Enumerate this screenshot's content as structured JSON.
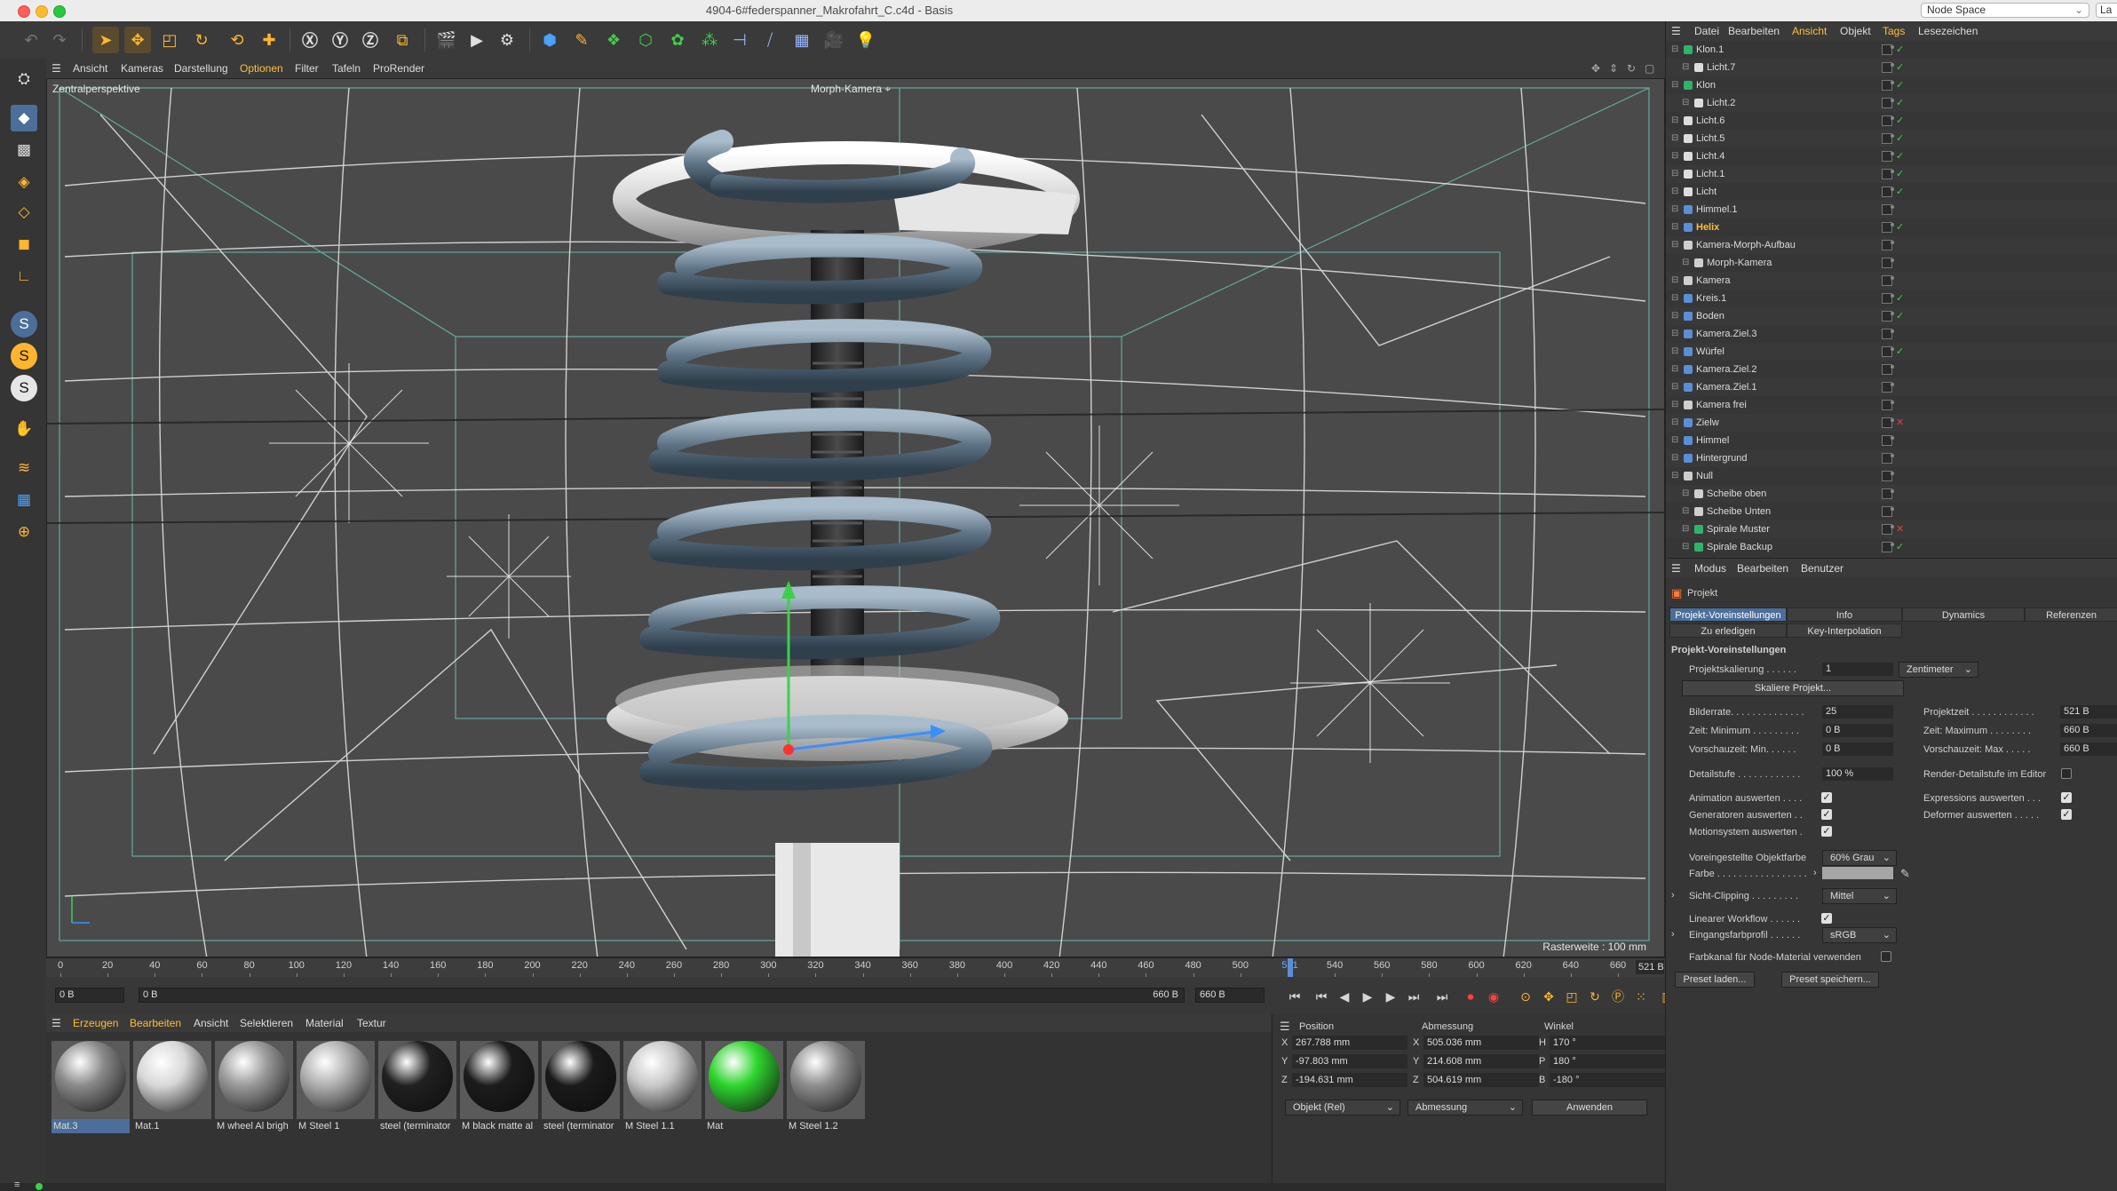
{
  "window": {
    "title": "4904-6#federspanner_Makrofahrt_C.c4d - Basis",
    "layout_label": "Node Space",
    "layout_extra": "La"
  },
  "viewport": {
    "menu": [
      "Ansicht",
      "Kameras",
      "Darstellung",
      "Optionen",
      "Filter",
      "Tafeln",
      "ProRender"
    ],
    "active_menu_index": 3,
    "projection": "Zentralperspektive",
    "camera": "Morph-Kamera",
    "grid_info": "Rasterweite : 100 mm"
  },
  "timeline": {
    "ticks": [
      "0",
      "20",
      "40",
      "60",
      "80",
      "100",
      "120",
      "140",
      "160",
      "180",
      "200",
      "220",
      "240",
      "260",
      "280",
      "300",
      "320",
      "340",
      "360",
      "380",
      "400",
      "420",
      "440",
      "460",
      "480",
      "500",
      "521",
      "540",
      "560",
      "580",
      "600",
      "620",
      "640",
      "660"
    ],
    "current_frame_marker": "521",
    "frame_display": "521 B",
    "start_field": "0 B",
    "range_start": "0 B",
    "range_end": "660 B",
    "end_field": "660 B"
  },
  "material_manager": {
    "menu": [
      "Erzeugen",
      "Bearbeiten",
      "Ansicht",
      "Selektieren",
      "Material",
      "Textur"
    ],
    "materials": [
      {
        "name": "Mat.3",
        "color": "#8a8a8a",
        "selected": true
      },
      {
        "name": "Mat.1",
        "color": "#d8d8d8",
        "selected": false
      },
      {
        "name": "M wheel Al brigh",
        "color": "#9a9a9a",
        "selected": false
      },
      {
        "name": "M Steel 1",
        "color": "#b0b0b0",
        "selected": false
      },
      {
        "name": "steel (terminator",
        "color": "#202020",
        "selected": false
      },
      {
        "name": "M black matte al",
        "color": "#1c1c1c",
        "selected": false
      },
      {
        "name": "steel (terminator",
        "color": "#1a1a1a",
        "selected": false
      },
      {
        "name": "M Steel 1.1",
        "color": "#c8c8c8",
        "selected": false
      },
      {
        "name": "Mat",
        "color": "#2ed52e",
        "selected": false
      },
      {
        "name": "M Steel 1.2",
        "color": "#8e8e8e",
        "selected": false
      }
    ]
  },
  "coordinates": {
    "headers": [
      "Position",
      "Abmessung",
      "Winkel"
    ],
    "rows": [
      {
        "axis": "X",
        "pos": "267.788 mm",
        "size_axis": "X",
        "size": "505.036 mm",
        "rot_axis": "H",
        "rot": "170 °"
      },
      {
        "axis": "Y",
        "pos": "-97.803 mm",
        "size_axis": "Y",
        "size": "214.608 mm",
        "rot_axis": "P",
        "rot": "180 °"
      },
      {
        "axis": "Z",
        "pos": "-194.631 mm",
        "size_axis": "Z",
        "size": "504.619 mm",
        "rot_axis": "B",
        "rot": "-180 °"
      }
    ],
    "mode": "Objekt (Rel)",
    "size_mode": "Abmessung",
    "apply": "Anwenden"
  },
  "object_manager": {
    "menu": [
      "Datei",
      "Bearbeiten",
      "Ansicht",
      "Objekt",
      "Tags",
      "Lesezeichen"
    ],
    "objects": [
      {
        "name": "Klon.1",
        "indent": 0,
        "icon": "#2fb36a",
        "state": "check",
        "highlight": false
      },
      {
        "name": "Licht.7",
        "indent": 1,
        "icon": "#dddddd",
        "state": "check",
        "highlight": false
      },
      {
        "name": "Klon",
        "indent": 0,
        "icon": "#2fb36a",
        "state": "check",
        "highlight": false
      },
      {
        "name": "Licht.2",
        "indent": 1,
        "icon": "#dddddd",
        "state": "check",
        "highlight": false
      },
      {
        "name": "Licht.6",
        "indent": 0,
        "icon": "#dddddd",
        "state": "check",
        "highlight": false
      },
      {
        "name": "Licht.5",
        "indent": 0,
        "icon": "#dddddd",
        "state": "check",
        "highlight": false
      },
      {
        "name": "Licht.4",
        "indent": 0,
        "icon": "#dddddd",
        "state": "check",
        "highlight": false
      },
      {
        "name": "Licht.1",
        "indent": 0,
        "icon": "#dddddd",
        "state": "check",
        "highlight": false
      },
      {
        "name": "Licht",
        "indent": 0,
        "icon": "#dddddd",
        "state": "check",
        "highlight": false
      },
      {
        "name": "Himmel.1",
        "indent": 0,
        "icon": "#5a8fd8",
        "state": "none",
        "highlight": false
      },
      {
        "name": "Helix",
        "indent": 0,
        "icon": "#5a8fd8",
        "state": "check",
        "highlight": true
      },
      {
        "name": "Kamera-Morph-Aufbau",
        "indent": 0,
        "icon": "#cfcfcf",
        "state": "none",
        "highlight": false
      },
      {
        "name": "Morph-Kamera",
        "indent": 1,
        "icon": "#cfcfcf",
        "state": "none",
        "highlight": false
      },
      {
        "name": "Kamera",
        "indent": 0,
        "icon": "#cfcfcf",
        "state": "none",
        "highlight": false
      },
      {
        "name": "Kreis.1",
        "indent": 0,
        "icon": "#5a8fd8",
        "state": "check",
        "highlight": false
      },
      {
        "name": "Boden",
        "indent": 0,
        "icon": "#5a8fd8",
        "state": "check",
        "highlight": false
      },
      {
        "name": "Kamera.Ziel.3",
        "indent": 0,
        "icon": "#5a8fd8",
        "state": "none",
        "highlight": false
      },
      {
        "name": "Würfel",
        "indent": 0,
        "icon": "#5a8fd8",
        "state": "check",
        "highlight": false
      },
      {
        "name": "Kamera.Ziel.2",
        "indent": 0,
        "icon": "#5a8fd8",
        "state": "none",
        "highlight": false
      },
      {
        "name": "Kamera.Ziel.1",
        "indent": 0,
        "icon": "#5a8fd8",
        "state": "none",
        "highlight": false
      },
      {
        "name": "Kamera frei",
        "indent": 0,
        "icon": "#cfcfcf",
        "state": "none",
        "highlight": false
      },
      {
        "name": "Zielw",
        "indent": 0,
        "icon": "#5a8fd8",
        "state": "cross",
        "highlight": false
      },
      {
        "name": "Himmel",
        "indent": 0,
        "icon": "#5a8fd8",
        "state": "none",
        "highlight": false
      },
      {
        "name": "Hintergrund",
        "indent": 0,
        "icon": "#5a8fd8",
        "state": "none",
        "highlight": false
      },
      {
        "name": "Null",
        "indent": 0,
        "icon": "#cfcfcf",
        "state": "none",
        "highlight": false
      },
      {
        "name": "Scheibe oben",
        "indent": 1,
        "icon": "#cfcfcf",
        "state": "none",
        "highlight": false
      },
      {
        "name": "Scheibe Unten",
        "indent": 1,
        "icon": "#cfcfcf",
        "state": "none",
        "highlight": false
      },
      {
        "name": "Spirale Muster",
        "indent": 1,
        "icon": "#2fb36a",
        "state": "cross",
        "highlight": false
      },
      {
        "name": "Spirale Backup",
        "indent": 1,
        "icon": "#2fb36a",
        "state": "check",
        "highlight": false
      }
    ]
  },
  "attributes": {
    "menu": [
      "Modus",
      "Bearbeiten",
      "Benutzer"
    ],
    "section": "Projekt",
    "tabs_row1": [
      "Projekt-Voreinstellungen",
      "Info",
      "Dynamics",
      "Referenzen"
    ],
    "tabs_row2": [
      "Zu erledigen",
      "Key-Interpolation"
    ],
    "heading": "Projekt-Voreinstellungen",
    "projektskalierung_label": "Projektskalierung . . . . . .",
    "projektskalierung_value": "1",
    "projektskalierung_unit": "Zentimeter",
    "skaliere_button": "Skaliere Projekt...",
    "bilderrate_label": "Bilderrate. . . . . . . . . . . . . .",
    "bilderrate": "25",
    "zeit_min_label": "Zeit: Minimum . . . . . . . . .",
    "zeit_min": "0 B",
    "vorschau_min_label": "Vorschauzeit: Min. . . . . .",
    "vorschau_min": "0 B",
    "projektzeit_label": "Projektzeit . . . . . . . . . . . .",
    "projektzeit": "521 B",
    "zeit_max_label": "Zeit: Maximum . . . . . . . .",
    "zeit_max": "660 B",
    "vorschau_max_label": "Vorschauzeit: Max . . . . .",
    "vorschau_max": "660 B",
    "detailstufe_label": "Detailstufe . . . . . . . . . . . .",
    "detailstufe": "100 %",
    "render_detail_label": "Render-Detailstufe im Editor",
    "anim_label": "Animation auswerten . . . .",
    "gen_label": "Generatoren auswerten . .",
    "motion_label": "Motionsystem auswerten .",
    "expr_label": "Expressions auswerten . . .",
    "deform_label": "Deformer auswerten . . . . .",
    "objfarbe_label": "Voreingestellte Objektfarbe",
    "objfarbe": "60% Grau",
    "farbe_label": "Farbe . . . . . . . . . . . . . . . . .",
    "clipping_label": "Sicht-Clipping . . . . . . . . .",
    "clipping": "Mittel",
    "linear_label": "Linearer Workflow . . . . . .",
    "farbprofil_label": "Eingangsfarbprofil . . . . . .",
    "farbprofil": "sRGB",
    "node_label": "Farbkanal für Node-Material verwenden",
    "preset_load": "Preset laden...",
    "preset_save": "Preset speichern..."
  }
}
